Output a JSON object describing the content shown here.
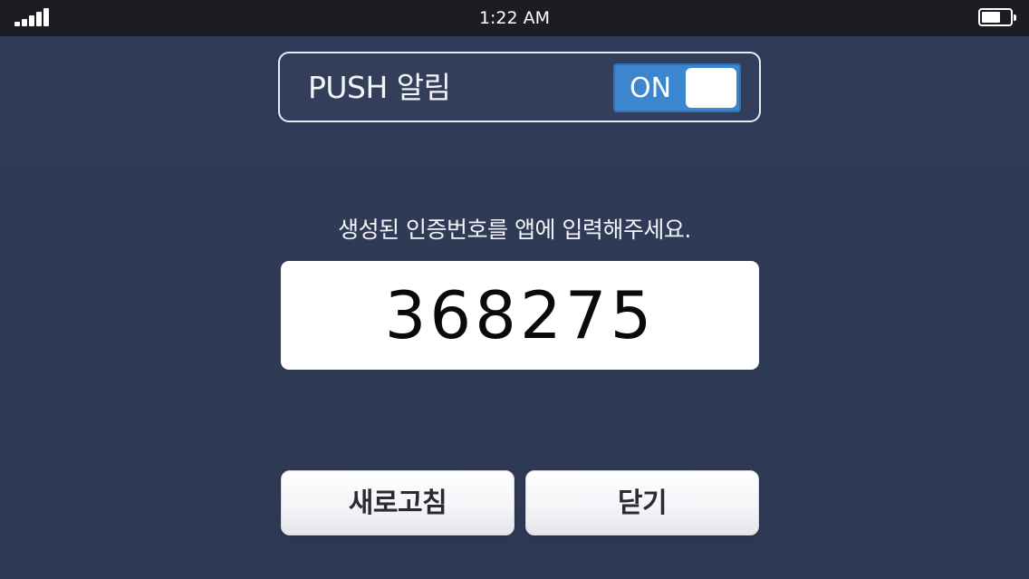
{
  "status_bar": {
    "time": "1:22 AM",
    "signal_icon": "signal-bars-icon",
    "battery_icon": "battery-icon",
    "battery_level": 0.65
  },
  "push": {
    "label": "PUSH 알림",
    "toggle_text": "ON",
    "toggle_on": true,
    "accent_color": "#3b86cf"
  },
  "auth": {
    "instruction": "생성된 인증번호를 앱에 입력해주세요.",
    "code": "368275"
  },
  "buttons": {
    "refresh_label": "새로고침",
    "close_label": "닫기"
  },
  "colors": {
    "background": "#2f3b58",
    "status_bar": "#1c1d21"
  }
}
